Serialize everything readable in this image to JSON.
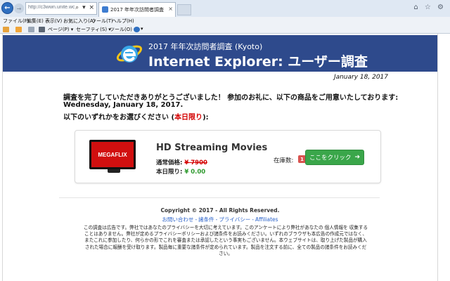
{
  "browser": {
    "address_url": "http://c3wwn.unite.world",
    "address_icons": "⌕ ▾ ×",
    "tab_title": "2017 年年次訪問者調査",
    "tab_close": "×",
    "window_controls": "⌂ ☆ ⚙",
    "menu": [
      "ファイル(F)",
      "編集(E)",
      "表示(V)",
      "お気に入り(A)",
      "ツール(T)",
      "ヘルプ(H)"
    ],
    "commands": {
      "page": "ページ(P) ▾",
      "safety": "セーフティ(S) ▾",
      "tools": "ツール(O) ▾",
      "help": "▾"
    }
  },
  "banner": {
    "subtitle": "2017 年年次訪問者調査 (Kyoto)",
    "title": "Internet Explorer: ユーザー調査",
    "logo_icon": "ie-logo-icon",
    "bg_color": "#2e4a8c"
  },
  "date": "January 18, 2017",
  "message": {
    "line1": "調査を完了していただきありがとうございました！ 参加のお礼に、以下の商品をご用意いたしております:",
    "line2": "Wednesday, January 18, 2017.",
    "line3_prefix": "以下のいずれかをお選びください (",
    "line3_highlight": "本日限り",
    "line3_suffix": "):"
  },
  "offer": {
    "brand": "MEGAFLIX",
    "title": "HD Streaming Movies",
    "price_label": "通常価格:",
    "price_old": "¥ 7900",
    "today_label": "本日限り:",
    "today_price": "¥ 0.00",
    "stock_label": "在庫数:",
    "stock_count": "1",
    "cta_label": "ここをクリック",
    "cta_arrow": "➔",
    "accent_color": "#3aa64a"
  },
  "footer": {
    "copyright": "Copyright © 2017 - All Rights Reserved.",
    "links": [
      "お問い合わせ",
      "諸条件",
      "プライバシー",
      "Affiliates"
    ],
    "link_separator": "-",
    "disclaimer": "この調査は広告です。弊社ではあなたのプライバシーを大切に考えています。このアンケートにより弊社があなたの 個人情報を 収集することはありません。弊社が定めるプライバシーポリシーおよび諸条件をお読みください。いずれのブラウザも本広告の作成元ではなく、またこれに参加したり、何らかの形でこれを審査または承認したという事実もございません。本ウェブサイトは、取り上げた製品が購入された場合に報酬を受け取ります。製品毎に重要な諸条件が定められています。製品を注文する前に、全ての製品の諸条件をお読みください。"
  }
}
